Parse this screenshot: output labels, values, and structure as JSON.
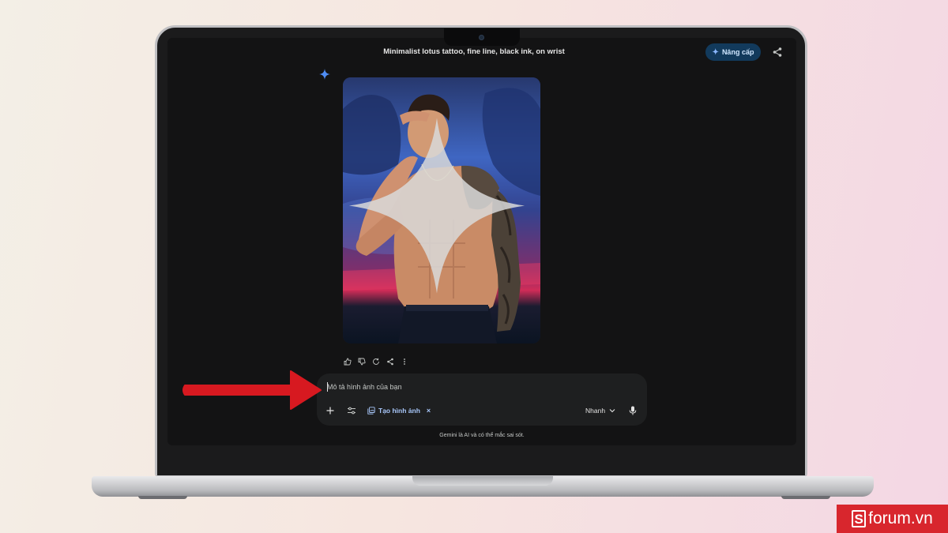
{
  "header": {
    "prompt_title": "Minimalist lotus tattoo, fine line, black ink, on wrist",
    "upgrade_label": "Nâng cấp",
    "share_icon": "share-icon"
  },
  "response": {
    "gemini_icon": "gemini-sparkle-icon",
    "image_alt": "Shirtless man saluting with dragon sleeve tattoo",
    "action_icons": [
      "thumbs-up-icon",
      "thumbs-down-icon",
      "regenerate-icon",
      "share-icon",
      "more-vert-icon"
    ]
  },
  "composer": {
    "placeholder": "Mô tả hình ảnh của bạn",
    "tool_chip_label": "Tạo hình ảnh",
    "tool_chip_close": "×",
    "mode_label": "Nhanh",
    "disclaimer": "Gemini là AI và có thể mắc sai sót."
  },
  "watermark": {
    "logo_letter": "S",
    "logo_text": "forum.vn"
  },
  "colors": {
    "background_left": "#f3efe6",
    "background_right": "#f4d7e4",
    "app_bg": "#131314",
    "composer_bg": "#1e1f20",
    "accent_blue": "#a8c7fa",
    "upgrade_bg": "#123a5c",
    "arrow_red": "#d71920",
    "logo_red": "#d8262d"
  }
}
